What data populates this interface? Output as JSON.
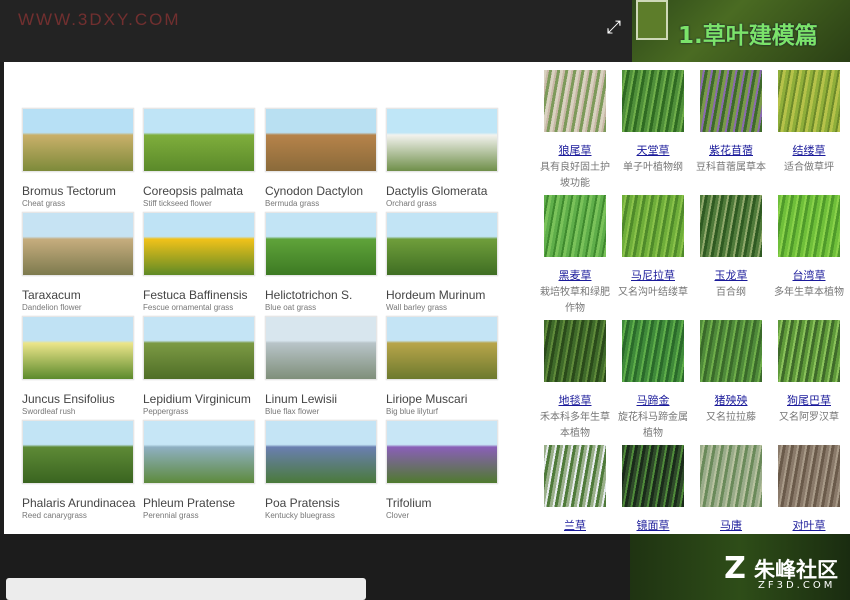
{
  "header": {
    "brand": "WWW.3DXY.COM",
    "expand_icon": "expand-icon",
    "tutorial_title": "1.草叶建模篇"
  },
  "grid_items": [
    {
      "name": "Bromus Tectorum",
      "sub": "Cheat grass",
      "colors": [
        "#b7e0f5",
        "#c9b06a",
        "#7d8a3a"
      ]
    },
    {
      "name": "Coreopsis palmata",
      "sub": "Stiff tickseed flower",
      "colors": [
        "#bfe4f6",
        "#7fae3c",
        "#5b8a2a"
      ]
    },
    {
      "name": "Cynodon Dactylon",
      "sub": "Bermuda grass",
      "colors": [
        "#b9e0f2",
        "#b6834a",
        "#8a6a3a"
      ]
    },
    {
      "name": "Dactylis Glomerata",
      "sub": "Orchard grass",
      "colors": [
        "#bfe6f7",
        "#f2f2ee",
        "#6f8f4a"
      ]
    },
    {
      "name": "Taraxacum",
      "sub": "Dandelion flower",
      "colors": [
        "#c6e3f3",
        "#c6ad7e",
        "#7d7a4e"
      ]
    },
    {
      "name": "Festuca Baffinensis",
      "sub": "Fescue ornamental grass",
      "colors": [
        "#bfe3f5",
        "#f1c21a",
        "#5f8a25"
      ]
    },
    {
      "name": "Helictotrichon S.",
      "sub": "Blue oat grass",
      "colors": [
        "#c2e4f5",
        "#5fa33a",
        "#3d7a23"
      ]
    },
    {
      "name": "Hordeum Murinum",
      "sub": "Wall barley grass",
      "colors": [
        "#c2e4f5",
        "#6f9e3b",
        "#3f6e23"
      ]
    },
    {
      "name": "Juncus Ensifolius",
      "sub": "Swordleaf rush",
      "colors": [
        "#c0e2f4",
        "#ece58a",
        "#5c8a2c"
      ]
    },
    {
      "name": "Lepidium Virginicum",
      "sub": "Peppergrass",
      "colors": [
        "#c4e4f5",
        "#7c9a44",
        "#4f6e27"
      ]
    },
    {
      "name": "Linum Lewisii",
      "sub": "Blue flax flower",
      "colors": [
        "#d8e6ee",
        "#b8c4c8",
        "#7f8f7a"
      ]
    },
    {
      "name": "Liriope Muscari",
      "sub": "Big blue lilyturf",
      "colors": [
        "#c4e4f5",
        "#b8a54a",
        "#6d7a2e"
      ]
    },
    {
      "name": "Phalaris Arundinacea",
      "sub": "Reed canarygrass",
      "colors": [
        "#c2e4f5",
        "#5e8a36",
        "#3a6420"
      ]
    },
    {
      "name": "Phleum Pratense",
      "sub": "Perennial grass",
      "colors": [
        "#c6e6f6",
        "#8fb0c2",
        "#5d8a3c"
      ]
    },
    {
      "name": "Poa Pratensis",
      "sub": "Kentucky bluegrass",
      "colors": [
        "#c4e4f5",
        "#6a7fb0",
        "#4a7a3a"
      ]
    },
    {
      "name": "Trifolium",
      "sub": "Clover",
      "colors": [
        "#c8e6f6",
        "#8a5fb8",
        "#4f7a2e"
      ]
    }
  ],
  "right_items": [
    {
      "name": "狼尾草",
      "desc": "具有良好固土护坡功能",
      "colors": [
        "#d9d2c0",
        "#c9b8a8",
        "#7d9a5a"
      ]
    },
    {
      "name": "天堂草",
      "desc": "单子叶植物纲",
      "colors": [
        "#4f8f3a",
        "#6fae4a",
        "#2f6a22"
      ]
    },
    {
      "name": "紫花苜蓿",
      "desc": "豆科苜蓿属草本",
      "colors": [
        "#7a9a4a",
        "#8a6ab0",
        "#3e6a2a"
      ]
    },
    {
      "name": "结缕草",
      "desc": "适合做草坪",
      "colors": [
        "#8fae3a",
        "#6d8a2a",
        "#b6c24a"
      ]
    },
    {
      "name": "黑麦草",
      "desc": "栽培牧草和绿肥作物",
      "colors": [
        "#5fae4a",
        "#3f8a2e",
        "#7ac25a"
      ]
    },
    {
      "name": "马尼拉草",
      "desc": "又名沟叶结缕草",
      "colors": [
        "#6fae3a",
        "#8ac24a",
        "#4f8a2a"
      ]
    },
    {
      "name": "玉龙草",
      "desc": "百合纲",
      "colors": [
        "#4f7a3a",
        "#8fa86a",
        "#2f5a22"
      ]
    },
    {
      "name": "台湾草",
      "desc": "多年生草本植物",
      "colors": [
        "#6fbf3a",
        "#8ad24a",
        "#4f9a2a"
      ]
    },
    {
      "name": "地毯草",
      "desc": "禾本科多年生草本植物",
      "colors": [
        "#3f6a2a",
        "#5f8a3a",
        "#2a4a1a"
      ]
    },
    {
      "name": "马蹄金",
      "desc": "旋花科马蹄金属植物",
      "colors": [
        "#3f8a3a",
        "#5fae4a",
        "#2a6a2a"
      ]
    },
    {
      "name": "猪殃殃",
      "desc": "又名拉拉藤",
      "colors": [
        "#4f8a3a",
        "#6fae4a",
        "#3a6a2a"
      ]
    },
    {
      "name": "狗尾巴草",
      "desc": "又名阿罗汉草",
      "colors": [
        "#5f9a3a",
        "#8ac25a",
        "#3f6a2a"
      ]
    },
    {
      "name": "兰草",
      "desc": "",
      "colors": [
        "#9ab08a",
        "#e8ecef",
        "#4f7a3a"
      ]
    },
    {
      "name": "镜面草",
      "desc": "",
      "colors": [
        "#2f4a2a",
        "#4f8a3a",
        "#1a2a1a"
      ]
    },
    {
      "name": "马唐",
      "desc": "",
      "colors": [
        "#9aac8a",
        "#b8c2a0",
        "#6a8a5a"
      ]
    },
    {
      "name": "对叶草",
      "desc": "",
      "colors": [
        "#8a7a6a",
        "#a89a88",
        "#6a5a4a"
      ]
    }
  ],
  "footer": {
    "logo_mark": "Z",
    "logo_text": "朱峰社区",
    "logo_sub": "ZF3D.COM"
  }
}
